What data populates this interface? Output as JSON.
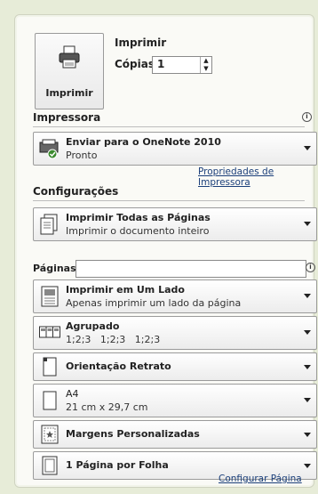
{
  "print": {
    "button_label": "Imprimir",
    "title": "Imprimir",
    "copies_label": "Cópias:",
    "copies_value": "1"
  },
  "printer": {
    "section_title": "Impressora",
    "name": "Enviar para o OneNote 2010",
    "status": "Pronto",
    "properties_link": "Propriedades de Impressora"
  },
  "settings": {
    "section_title": "Configurações",
    "print_what": {
      "title": "Imprimir Todas as Páginas",
      "subtitle": "Imprimir o documento inteiro"
    },
    "pages_label": "Páginas:",
    "pages_value": "",
    "sides": {
      "title": "Imprimir em Um Lado",
      "subtitle": "Apenas imprimir um lado da página"
    },
    "collate": {
      "title": "Agrupado",
      "subtitle": "1;2;3   1;2;3   1;2;3"
    },
    "orientation": {
      "title": "Orientação Retrato"
    },
    "paper": {
      "title": "A4",
      "subtitle": "21 cm x 29,7 cm"
    },
    "margins": {
      "title": "Margens Personalizadas"
    },
    "per_sheet": {
      "title": "1 Página por Folha"
    },
    "page_setup_link": "Configurar Página"
  }
}
